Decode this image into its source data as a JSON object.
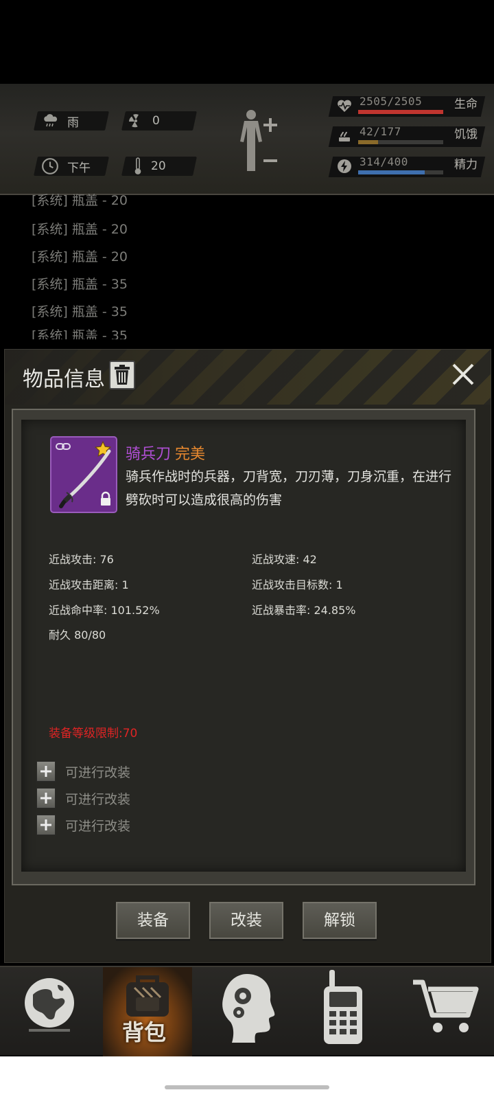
{
  "status": {
    "weather": "雨",
    "radiation": "0",
    "time_of_day": "下午",
    "temperature": "20",
    "health": {
      "value": "2505/2505",
      "label": "生命",
      "fraction": 1.0,
      "color": "#c0352f"
    },
    "hunger": {
      "value": "42/177",
      "label": "饥饿",
      "fraction": 0.237,
      "color": "#8a6a2a"
    },
    "energy": {
      "value": "314/400",
      "label": "精力",
      "fraction": 0.785,
      "color": "#3f6fae"
    }
  },
  "log": {
    "lines": [
      "[系统] 瓶盖 - 20",
      "[系统] 瓶盖 - 20",
      "[系统] 瓶盖 - 20",
      "[系统] 瓶盖 - 35",
      "[系统] 瓶盖 - 35",
      "[系统] 瓶盖 - 35"
    ]
  },
  "dialog": {
    "title": "物品信息",
    "item": {
      "name": "骑兵刀",
      "quality": "完美",
      "description": "骑兵作战时的兵器，刀背宽，刀刃薄，刀身沉重，在进行劈砍时可以造成很高的伤害"
    },
    "stats": {
      "melee_attack": "近战攻击: 76",
      "melee_speed": "近战攻速: 42",
      "melee_range": "近战攻击距离: 1",
      "melee_targets": "近战攻击目标数: 1",
      "melee_hit": "近战命中率: 101.52%",
      "melee_crit": "近战暴击率: 24.85%",
      "durability": "耐久 80/80"
    },
    "level_requirement": "装备等级限制:70",
    "mods": [
      "可进行改装",
      "可进行改装",
      "可进行改装"
    ],
    "buttons": {
      "equip": "装备",
      "modify": "改装",
      "unlock": "解锁"
    }
  },
  "nav": {
    "bag_label": "背包",
    "active": "bag"
  },
  "colors": {
    "quality_purple": "#b14fd6",
    "quality_orange": "#e8892f",
    "requirement_red": "#e02424"
  }
}
